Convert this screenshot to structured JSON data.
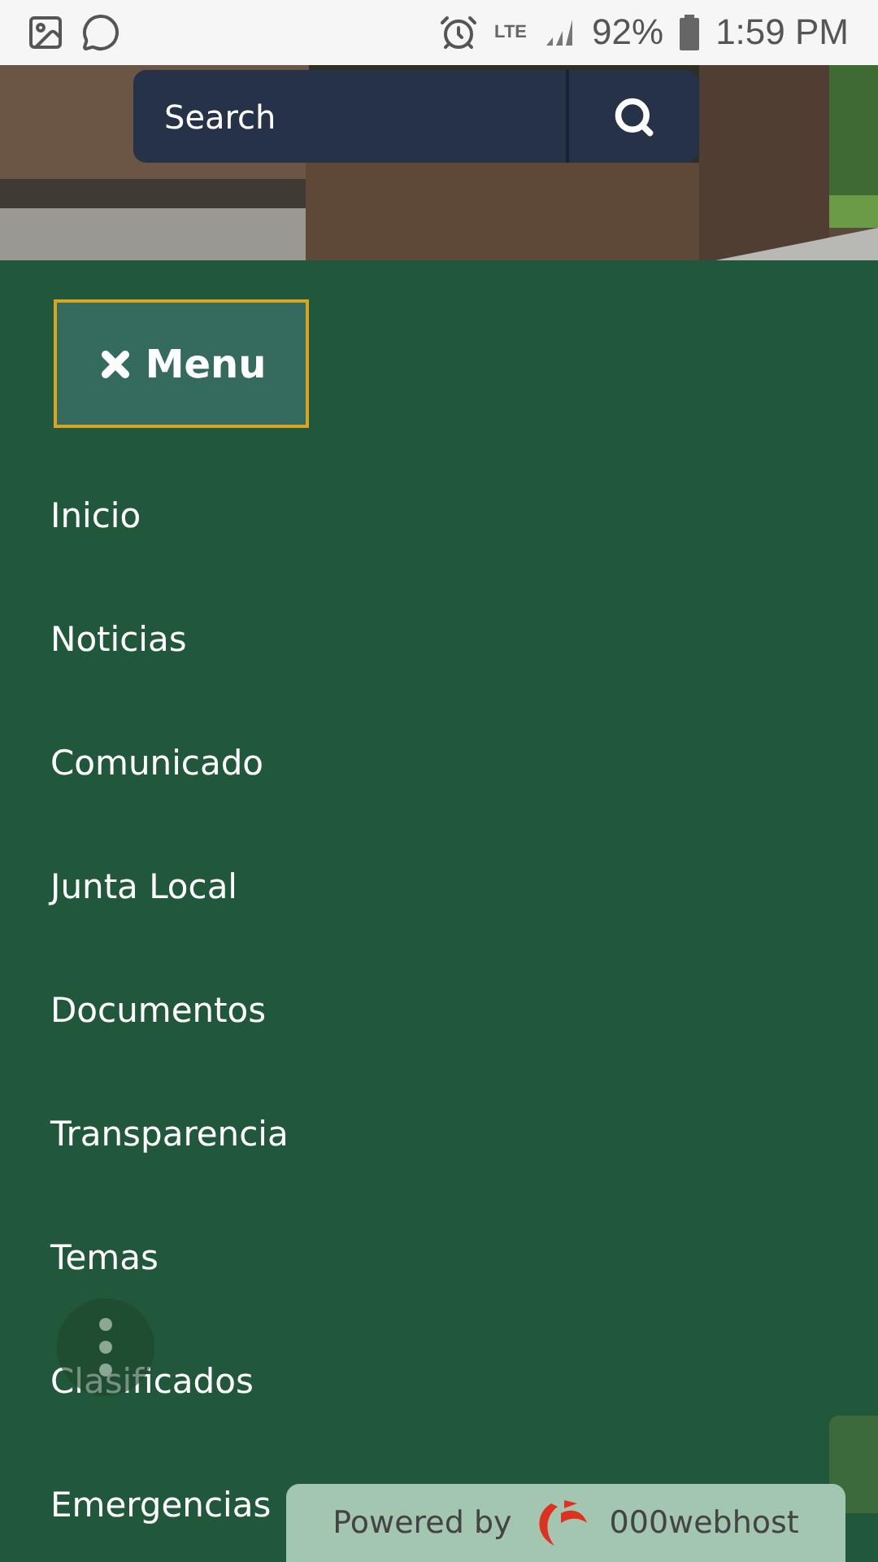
{
  "status_bar": {
    "battery": "92%",
    "time": "1:59 PM",
    "network": "LTE"
  },
  "search": {
    "placeholder": "Search"
  },
  "menu_button": {
    "label": "Menu",
    "expanded": true
  },
  "nav_items": [
    {
      "label": "Inicio"
    },
    {
      "label": "Noticias"
    },
    {
      "label": "Comunicado"
    },
    {
      "label": "Junta Local"
    },
    {
      "label": "Documentos"
    },
    {
      "label": "Transparencia"
    },
    {
      "label": "Temas"
    },
    {
      "label": "Clasificados"
    },
    {
      "label": "Emergencias"
    }
  ],
  "powered_by": {
    "prefix": "Powered by",
    "brand": "000webhost"
  }
}
